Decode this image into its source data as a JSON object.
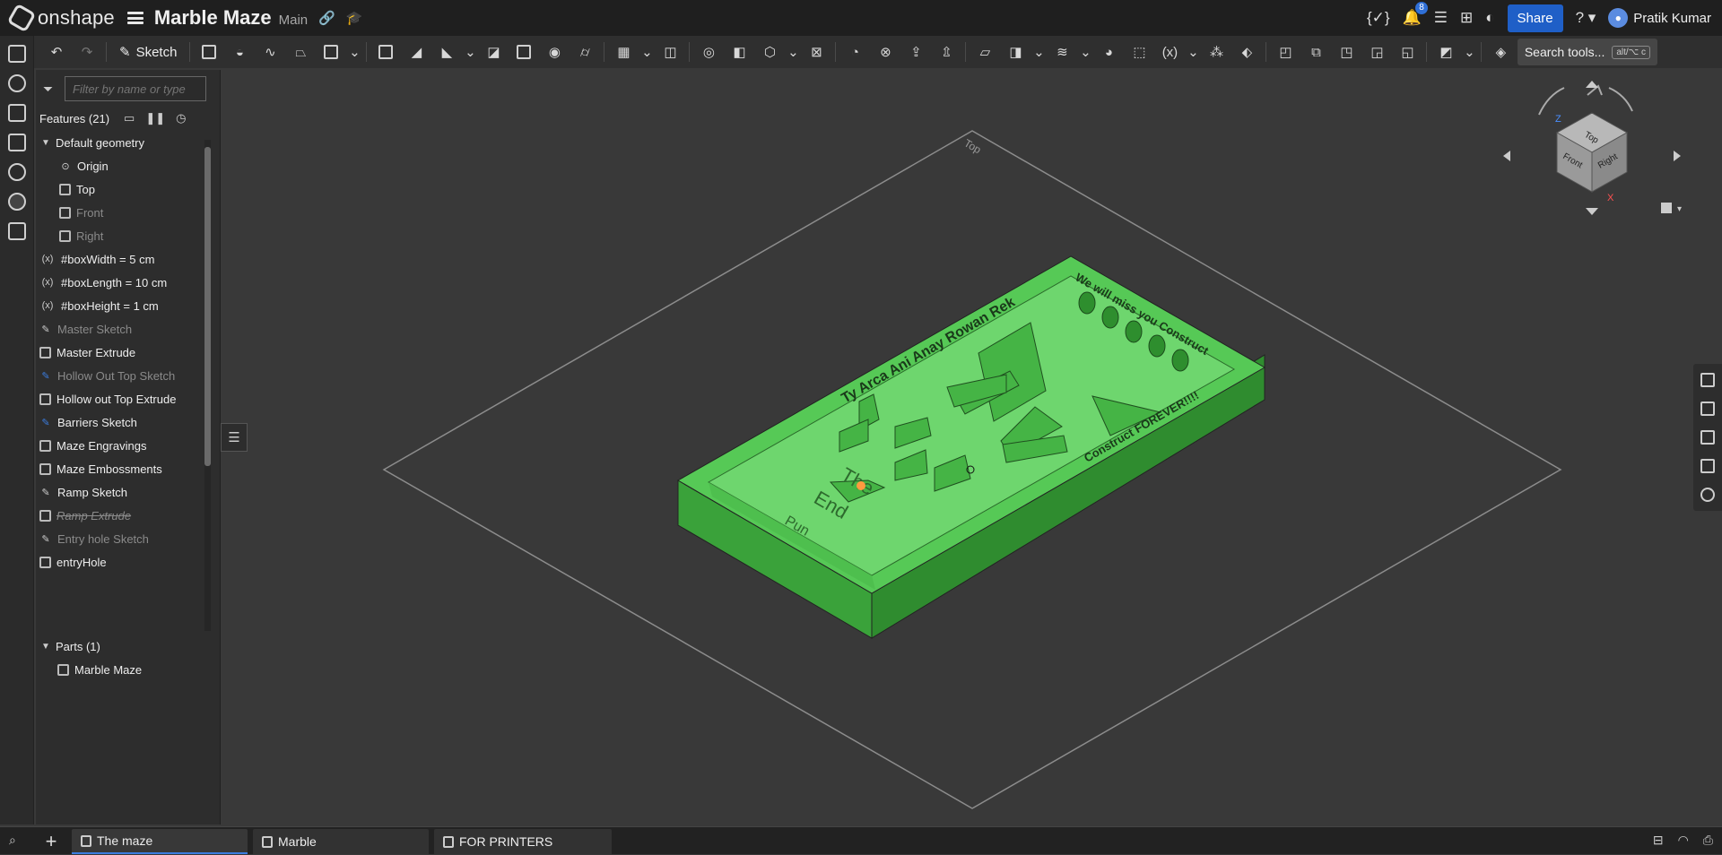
{
  "app": {
    "name": "onshape",
    "doc_title": "Marble Maze",
    "branch": "Main"
  },
  "topbar": {
    "notifications_count": "8",
    "share_label": "Share",
    "help_label": "?",
    "user_name": "Pratik Kumar"
  },
  "toolbar": {
    "sketch_label": "Sketch",
    "search_label": "Search tools...",
    "search_shortcut": "alt/⌥ c"
  },
  "panel": {
    "filter_placeholder": "Filter by name or type",
    "features_header": "Features (21)",
    "tree": [
      {
        "label": "Default geometry",
        "kind": "group",
        "state": "normal"
      },
      {
        "label": "Origin",
        "kind": "origin",
        "state": "normal"
      },
      {
        "label": "Top",
        "kind": "plane",
        "state": "normal"
      },
      {
        "label": "Front",
        "kind": "plane",
        "state": "dim"
      },
      {
        "label": "Right",
        "kind": "plane",
        "state": "dim"
      },
      {
        "label": "#boxWidth = 5 cm",
        "kind": "variable",
        "state": "normal"
      },
      {
        "label": "#boxLength = 10 cm",
        "kind": "variable",
        "state": "normal"
      },
      {
        "label": "#boxHeight = 1 cm",
        "kind": "variable",
        "state": "normal"
      },
      {
        "label": "Master Sketch",
        "kind": "sketch",
        "state": "dim"
      },
      {
        "label": "Master Extrude",
        "kind": "extrude",
        "state": "normal"
      },
      {
        "label": "Hollow Out Top Sketch",
        "kind": "sketch-error",
        "state": "dim"
      },
      {
        "label": "Hollow out Top Extrude",
        "kind": "extrude",
        "state": "normal"
      },
      {
        "label": "Barriers Sketch",
        "kind": "sketch-error",
        "state": "normal"
      },
      {
        "label": "Maze Engravings",
        "kind": "extrude",
        "state": "normal"
      },
      {
        "label": "Maze Embossments",
        "kind": "extrude",
        "state": "normal"
      },
      {
        "label": "Ramp Sketch",
        "kind": "sketch",
        "state": "normal"
      },
      {
        "label": "Ramp Extrude",
        "kind": "extrude",
        "state": "strike"
      },
      {
        "label": "Entry hole Sketch",
        "kind": "sketch",
        "state": "dim"
      },
      {
        "label": "entryHole",
        "kind": "extrude",
        "state": "normal"
      }
    ],
    "parts_header": "Parts (1)",
    "parts": [
      {
        "label": "Marble Maze"
      }
    ]
  },
  "viewport": {
    "plane_label": "Top",
    "cube_faces": {
      "top": "Top",
      "front": "Front",
      "right": "Right"
    },
    "axes": {
      "z": "Z",
      "x": "X"
    },
    "engravings": {
      "names": "Ty Arca Ani Anay Rowan Rek",
      "miss": "We will miss you Construct",
      "forever": "Construct FOREVER!!!!",
      "the": "The",
      "end": "End",
      "pun": "Pun"
    },
    "model_color": "#4cc24c"
  },
  "tabs": [
    {
      "label": "The maze",
      "active": true
    },
    {
      "label": "Marble",
      "active": false
    },
    {
      "label": "FOR PRINTERS",
      "active": false
    }
  ]
}
